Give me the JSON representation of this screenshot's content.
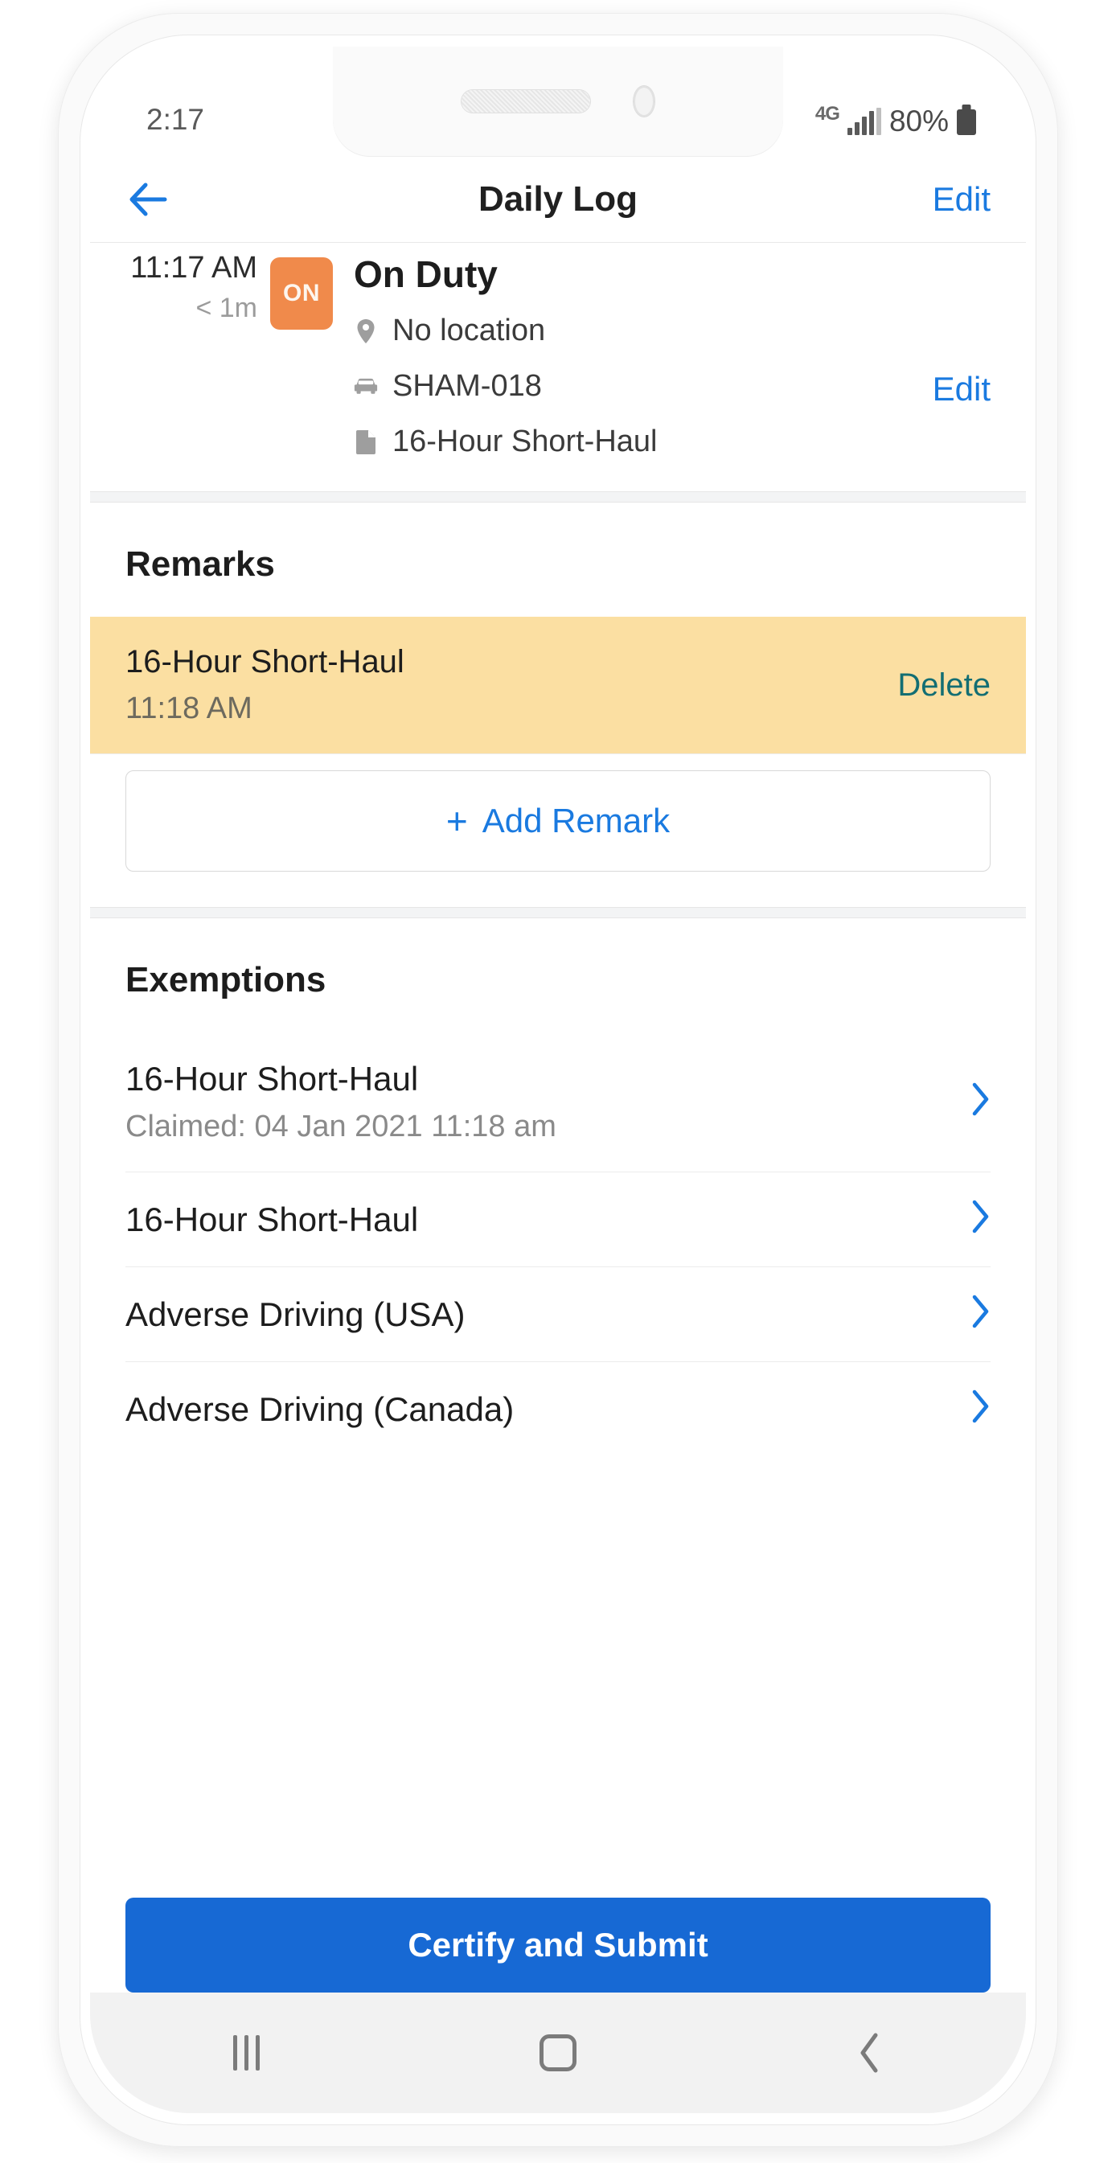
{
  "status_bar": {
    "time": "2:17",
    "network_type": "4G",
    "battery_percent": "80%",
    "signal_icon": "signal-bars-icon",
    "battery_icon": "battery-icon"
  },
  "header": {
    "title": "Daily Log",
    "back_icon": "back-arrow-icon",
    "edit_label": "Edit"
  },
  "duty_entry": {
    "time": "11:17 AM",
    "duration": "< 1m",
    "badge": "ON",
    "status": "On Duty",
    "edit_label": "Edit",
    "meta": [
      {
        "icon": "map-pin-icon",
        "text": "No location"
      },
      {
        "icon": "vehicle-icon",
        "text": "SHAM-018"
      },
      {
        "icon": "document-icon",
        "text": "16-Hour Short-Haul"
      }
    ]
  },
  "remarks": {
    "title": "Remarks",
    "items": [
      {
        "name": "16-Hour Short-Haul",
        "time": "11:18 AM",
        "action": "Delete"
      }
    ],
    "add_label": "Add Remark",
    "add_plus": "+"
  },
  "exemptions": {
    "title": "Exemptions",
    "items": [
      {
        "name": "16-Hour Short-Haul",
        "sub": "Claimed: 04 Jan 2021 11:18 am",
        "chevron": "chevron-right-icon"
      },
      {
        "name": "16-Hour Short-Haul",
        "sub": "",
        "chevron": "chevron-right-icon"
      },
      {
        "name": "Adverse Driving (USA)",
        "sub": "",
        "chevron": "chevron-right-icon"
      },
      {
        "name": "Adverse Driving (Canada)",
        "sub": "",
        "chevron": "chevron-right-icon"
      }
    ]
  },
  "cta": {
    "label": "Certify and Submit"
  },
  "nav_bar": {
    "recents": "recents-icon",
    "home": "home-icon",
    "back": "back-icon"
  },
  "colors": {
    "accent_blue": "#1a7ae0",
    "cta_blue": "#1769D4",
    "badge_orange": "#F08A4B",
    "remark_yellow": "#FBDFA2",
    "delete_teal": "#136e73"
  }
}
